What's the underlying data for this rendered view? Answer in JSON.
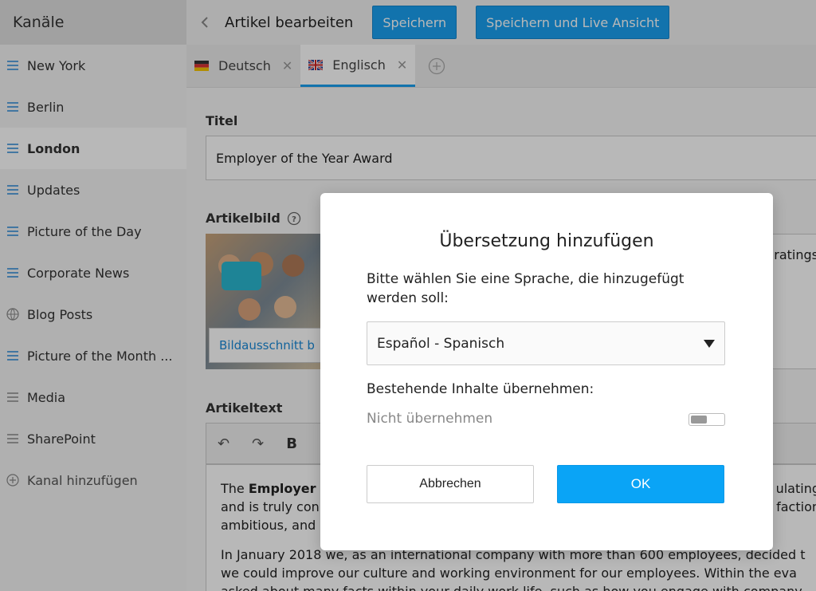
{
  "sidebar": {
    "header": "Kanäle",
    "items": [
      {
        "label": "New York",
        "icon": "list-icon"
      },
      {
        "label": "Berlin",
        "icon": "list-icon"
      },
      {
        "label": "London",
        "icon": "list-icon"
      },
      {
        "label": "Updates",
        "icon": "list-icon"
      },
      {
        "label": "Picture of the Day",
        "icon": "list-icon"
      },
      {
        "label": "Corporate News",
        "icon": "list-icon"
      },
      {
        "label": "Blog Posts",
        "icon": "globe-icon"
      },
      {
        "label": "Picture of the Month ...",
        "icon": "list-icon"
      },
      {
        "label": "Media",
        "icon": "list-icon-gray"
      },
      {
        "label": "SharePoint",
        "icon": "list-icon-gray"
      }
    ],
    "add_label": "Kanal hinzufügen",
    "active_index": 2
  },
  "topbar": {
    "title": "Artikel bearbeiten",
    "save_label": "Speichern",
    "save_live_label": "Speichern und Live Ansicht"
  },
  "tabs": [
    {
      "label": "Deutsch",
      "flag": "de-flag-icon"
    },
    {
      "label": "Englisch",
      "flag": "uk-flag-icon"
    }
  ],
  "form": {
    "title_label": "Titel",
    "title_value": "Employer of the Year Award",
    "image_label": "Artikelbild",
    "image_button": "Bildausschnitt b",
    "meta_text": "ratings",
    "text_label": "Artikeltext",
    "editor_lines": [
      "The Employer",
      "and is truly con",
      "ambitious, and"
    ],
    "editor_right_lines": [
      "ulating",
      "faction"
    ],
    "editor_p2_lines": [
      "In January 2018 we, as an international company with more than 600 employees, decided t",
      "we could improve our culture and working environment for our employees. Within the eva",
      "asked about many facts within your daily work life, such as how you engage with company"
    ]
  },
  "modal": {
    "title": "Übersetzung hinzufügen",
    "description": "Bitte wählen Sie eine Sprache, die hinzugefügt werden soll:",
    "select_value": "Español - Spanisch",
    "content_label": "Bestehende Inhalte übernehmen:",
    "toggle_label": "Nicht übernehmen",
    "cancel_label": "Abbrechen",
    "ok_label": "OK"
  }
}
